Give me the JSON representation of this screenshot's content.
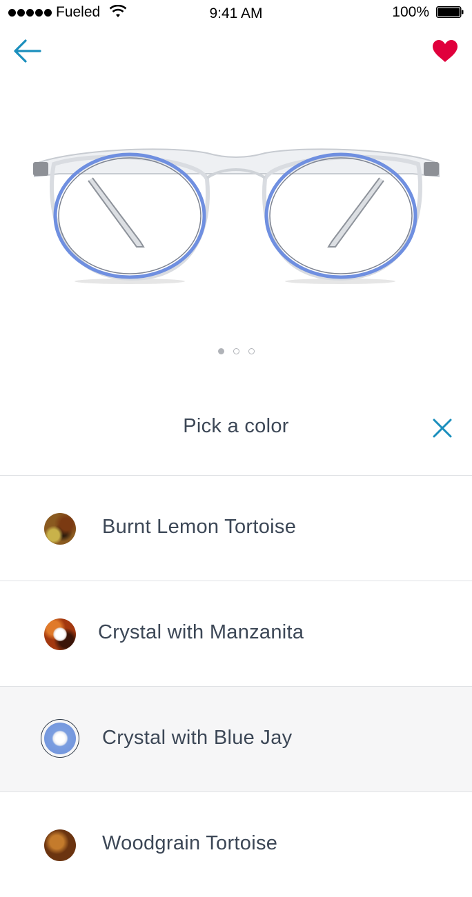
{
  "status_bar": {
    "carrier": "Fueled",
    "time": "9:41 AM",
    "battery": "100%"
  },
  "nav": {
    "back_icon": "arrow-left-icon",
    "favorite_icon": "heart-icon"
  },
  "colors": {
    "accent": "#1b8fbd",
    "heart": "#e0003c",
    "text": "#3c4756",
    "selected_row_bg": "#f6f6f7",
    "frame_blue": "#6f8fe0"
  },
  "carousel": {
    "page_count": 3,
    "current_page": 1
  },
  "picker": {
    "title": "Pick a color",
    "close_icon": "close-icon",
    "options": [
      {
        "label": "Burnt Lemon Tortoise",
        "selected": false
      },
      {
        "label": "Crystal with Manzanita",
        "selected": false
      },
      {
        "label": "Crystal with Blue Jay",
        "selected": true
      },
      {
        "label": "Woodgrain Tortoise",
        "selected": false
      }
    ]
  }
}
